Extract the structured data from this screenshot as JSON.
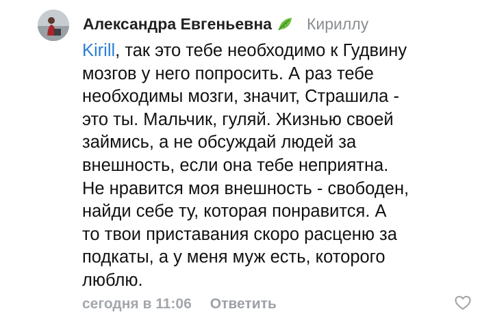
{
  "comment": {
    "author": "Александра Евгеньевна",
    "author_badge_icon": "leaf-icon",
    "reply_to": "Кириллу",
    "mention": "Kirill",
    "text_lines": [
      ", так это тебе необходимо к Гудвину",
      "мозгов у него попросить. А раз тебе",
      "необходимы мозги, значит, Страшила -",
      "это ты. Мальчик, гуляй. Жизнью своей",
      "займись, а не обсуждай людей за",
      "внешность, если она тебе неприятна.",
      "Не нравится моя внешность - свободен,",
      "найди себе ту, которая понравится. А",
      "то твои приставания скоро расценю за",
      "подкаты, а у меня муж есть, которого",
      "люблю."
    ],
    "timestamp": "сегодня в 11:06",
    "reply_label": "Ответить",
    "like_icon": "heart-outline-icon"
  },
  "colors": {
    "author": "#222222",
    "meta": "#8a8d91",
    "mention": "#2a7fd4",
    "text": "#111111",
    "footer": "#9da1a6",
    "leaf": "#6cbf3f"
  }
}
